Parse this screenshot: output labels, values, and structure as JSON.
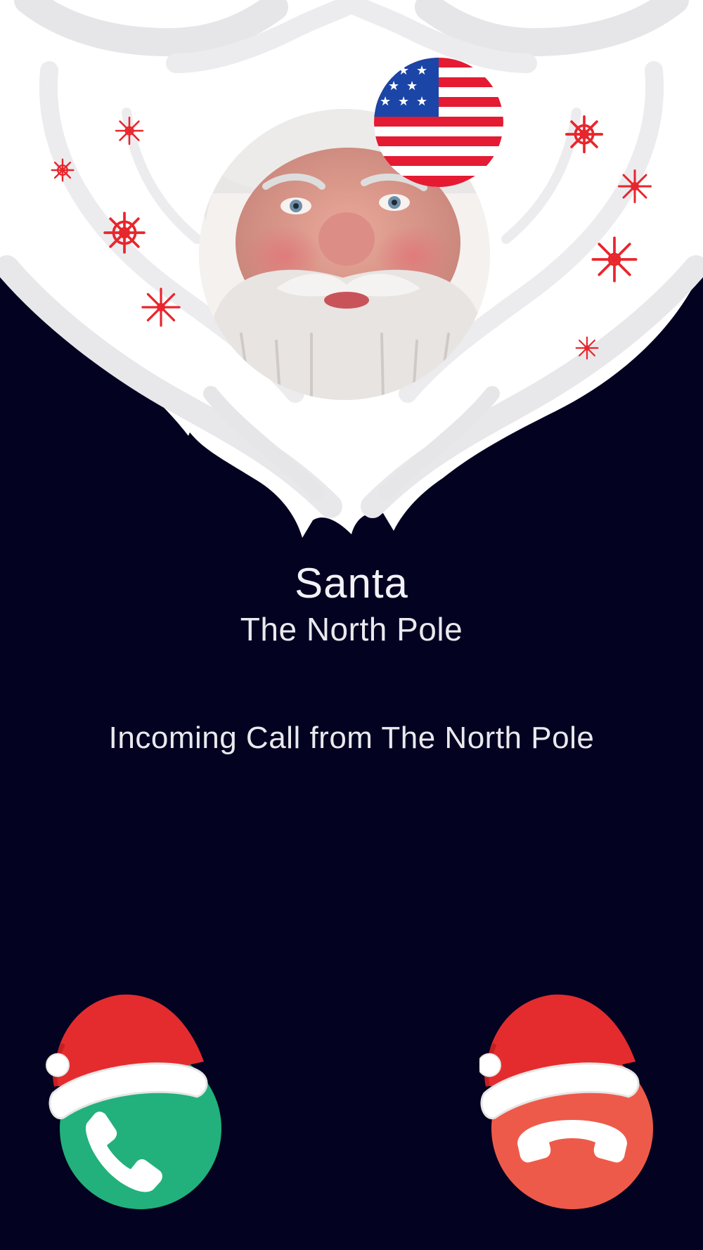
{
  "caller": {
    "name": "Santa",
    "location": "The North Pole"
  },
  "status_text": "Incoming Call from The North Pole",
  "flag": "us-flag",
  "buttons": {
    "accept": {
      "icon": "phone-icon",
      "color": "#22b17c"
    },
    "decline": {
      "icon": "hang-up-icon",
      "color": "#ee5a4a"
    }
  },
  "colors": {
    "background": "#030221",
    "snowflake": "#e8262d",
    "hat_red": "#e42c2e"
  }
}
